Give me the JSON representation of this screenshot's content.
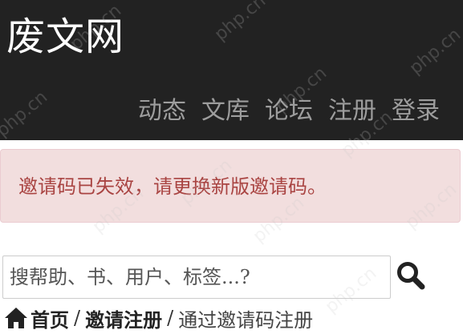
{
  "header": {
    "brand": "废文网",
    "nav": [
      "动态",
      "文库",
      "论坛",
      "注册",
      "登录"
    ]
  },
  "alert": {
    "message": "邀请码已失效，请更换新版邀请码。"
  },
  "search": {
    "placeholder": "搜帮助、书、用户、标签...?"
  },
  "breadcrumb": {
    "home": "首页",
    "separator": "/",
    "section": "邀请注册",
    "current": "通过邀请码注册"
  },
  "watermark": {
    "text": "php.cn"
  },
  "colors": {
    "header_bg": "#222222",
    "brand_text": "#ffffff",
    "nav_text": "#9d9d9d",
    "alert_bg": "#f2dede",
    "alert_border": "#ebccd1",
    "alert_text": "#a94442"
  }
}
